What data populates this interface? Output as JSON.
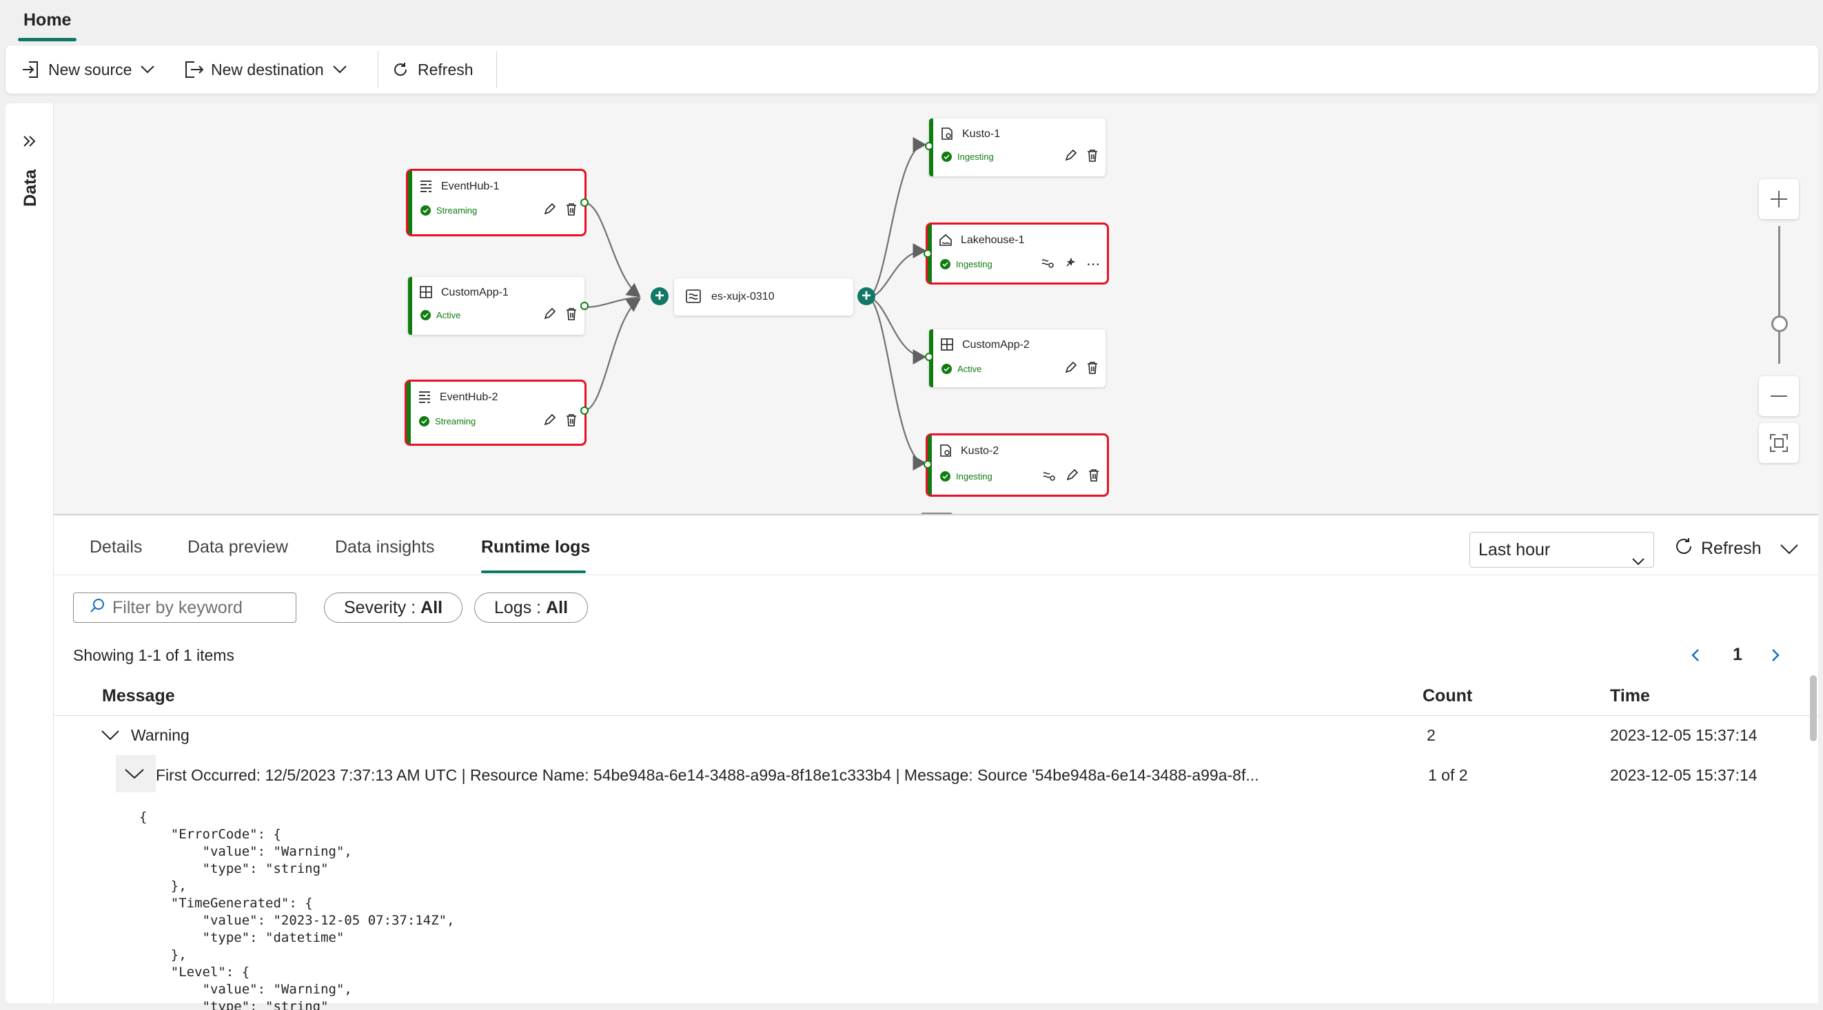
{
  "top_tab": "Home",
  "toolbar": {
    "new_source": "New source",
    "new_destination": "New destination",
    "refresh": "Refresh"
  },
  "rail": {
    "label": "Data"
  },
  "canvas": {
    "sources": [
      {
        "name": "EventHub-1",
        "status": "Streaming",
        "icon": "eventhub-icon",
        "selected": true
      },
      {
        "name": "CustomApp-1",
        "status": "Active",
        "icon": "custom-app-icon",
        "selected": false
      },
      {
        "name": "EventHub-2",
        "status": "Streaming",
        "icon": "eventhub-icon",
        "selected": true
      }
    ],
    "stream": {
      "name": "es-xujx-0310",
      "icon": "eventstream-icon"
    },
    "destinations": [
      {
        "name": "Kusto-1",
        "status": "Ingesting",
        "icon": "kusto-icon",
        "selected": false
      },
      {
        "name": "Lakehouse-1",
        "status": "Ingesting",
        "icon": "lakehouse-icon",
        "selected": true
      },
      {
        "name": "CustomApp-2",
        "status": "Active",
        "icon": "custom-app-icon",
        "selected": false
      },
      {
        "name": "Kusto-2",
        "status": "Ingesting",
        "icon": "kusto-icon",
        "selected": true
      }
    ],
    "colors": {
      "status_green": "#107c10",
      "accent": "#117865",
      "selection": "#e81123"
    }
  },
  "panel": {
    "tabs": [
      "Details",
      "Data preview",
      "Data insights",
      "Runtime logs"
    ],
    "active_tab": "Runtime logs",
    "time_range": "Last hour",
    "refresh": "Refresh",
    "filter_placeholder": "Filter by keyword",
    "severity_label": "Severity :",
    "severity_value": "All",
    "logs_label": "Logs :",
    "logs_value": "All",
    "showing": "Showing 1-1 of 1 items",
    "page": "1",
    "columns": {
      "message": "Message",
      "count": "Count",
      "time": "Time"
    },
    "rows": [
      {
        "message": "Warning",
        "count": "2",
        "time": "2023-12-05 15:37:14"
      },
      {
        "message": "First Occurred: 12/5/2023 7:37:13 AM UTC | Resource Name: 54be948a-6e14-3488-a99a-8f18e1c333b4 | Message: Source '54be948a-6e14-3488-a99a-8f...",
        "count": "1 of 2",
        "time": "2023-12-05 15:37:14"
      }
    ],
    "json_detail": "{\n    \"ErrorCode\": {\n        \"value\": \"Warning\",\n        \"type\": \"string\"\n    },\n    \"TimeGenerated\": {\n        \"value\": \"2023-12-05 07:37:14Z\",\n        \"type\": \"datetime\"\n    },\n    \"Level\": {\n        \"value\": \"Warning\",\n        \"type\": \"string\""
  }
}
